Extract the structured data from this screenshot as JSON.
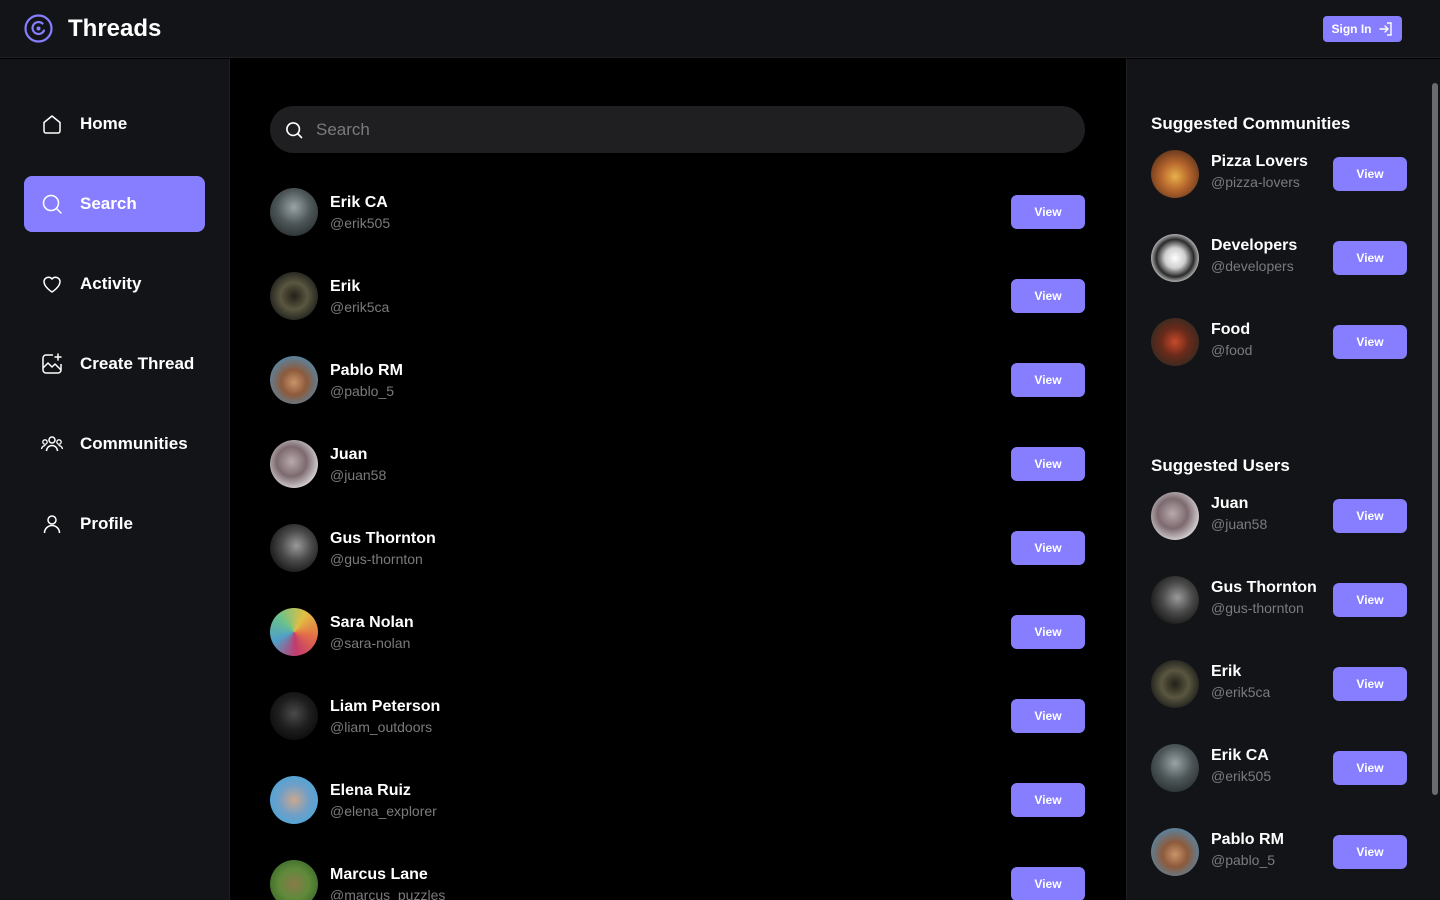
{
  "app": {
    "title": "Threads",
    "sign_in": "Sign In"
  },
  "colors": {
    "accent": "#877eff",
    "panel": "#121417",
    "input": "#1f1f22",
    "muted": "#7b7b7e"
  },
  "nav": [
    {
      "label": "Home",
      "icon": "home-icon"
    },
    {
      "label": "Search",
      "icon": "search-icon",
      "active": true
    },
    {
      "label": "Activity",
      "icon": "heart-icon"
    },
    {
      "label": "Create Thread",
      "icon": "create-thread-icon"
    },
    {
      "label": "Communities",
      "icon": "communities-icon"
    },
    {
      "label": "Profile",
      "icon": "profile-icon"
    }
  ],
  "search": {
    "placeholder": "Search",
    "value": ""
  },
  "users": [
    {
      "name": "Erik CA",
      "handle": "@erik505",
      "action": "View"
    },
    {
      "name": "Erik",
      "handle": "@erik5ca",
      "action": "View"
    },
    {
      "name": "Pablo RM",
      "handle": "@pablo_5",
      "action": "View"
    },
    {
      "name": "Juan",
      "handle": "@juan58",
      "action": "View"
    },
    {
      "name": "Gus Thornton",
      "handle": "@gus-thornton",
      "action": "View"
    },
    {
      "name": "Sara Nolan",
      "handle": "@sara-nolan",
      "action": "View"
    },
    {
      "name": "Liam Peterson",
      "handle": "@liam_outdoors",
      "action": "View"
    },
    {
      "name": "Elena Ruiz",
      "handle": "@elena_explorer",
      "action": "View"
    },
    {
      "name": "Marcus Lane",
      "handle": "@marcus_puzzles",
      "action": "View"
    }
  ],
  "suggested_communities": {
    "title": "Suggested Communities",
    "items": [
      {
        "name": "Pizza Lovers",
        "handle": "@pizza-lovers",
        "action": "View"
      },
      {
        "name": "Developers",
        "handle": "@developers",
        "action": "View"
      },
      {
        "name": "Food",
        "handle": "@food",
        "action": "View"
      }
    ]
  },
  "suggested_users": {
    "title": "Suggested Users",
    "items": [
      {
        "name": "Juan",
        "handle": "@juan58",
        "action": "View"
      },
      {
        "name": "Gus Thornton",
        "handle": "@gus-thornton",
        "action": "View"
      },
      {
        "name": "Erik",
        "handle": "@erik5ca",
        "action": "View"
      },
      {
        "name": "Erik CA",
        "handle": "@erik505",
        "action": "View"
      },
      {
        "name": "Pablo RM",
        "handle": "@pablo_5",
        "action": "View"
      }
    ]
  }
}
